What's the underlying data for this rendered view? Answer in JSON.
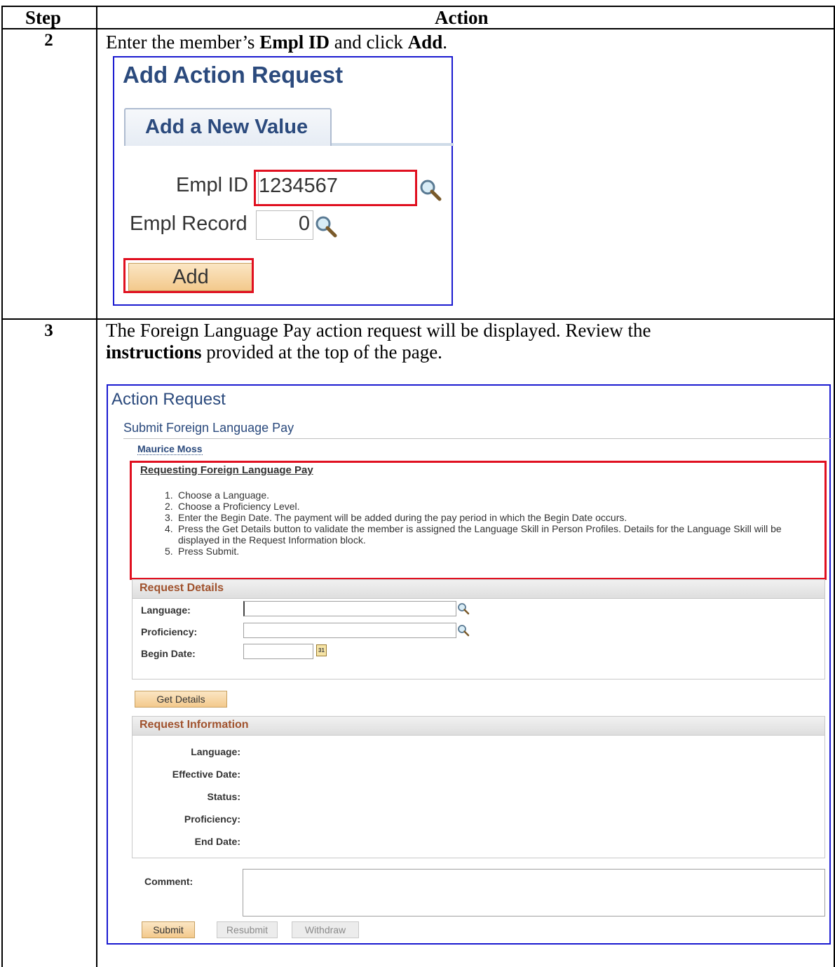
{
  "table": {
    "header": {
      "step": "Step",
      "action": "Action"
    }
  },
  "step2": {
    "number": "2",
    "instruction": {
      "text1": "Enter the member’s ",
      "bold1": "Empl ID",
      "text2": " and click ",
      "bold2": "Add",
      "text3": "."
    },
    "screen": {
      "title": "Add Action Request",
      "tab": "Add a New Value",
      "empl_id_label": "Empl ID",
      "empl_id_value": "1234567",
      "empl_record_label": "Empl Record",
      "empl_record_value": "0",
      "add_button": "Add"
    }
  },
  "step3": {
    "number": "3",
    "instruction": {
      "line1": "The Foreign Language Pay action request will be displayed.  Review the",
      "bold": "instructions",
      "line2": " provided at the top of the page."
    },
    "screen": {
      "title": "Action Request",
      "subtitle": "Submit Foreign Language Pay",
      "member_name": "Maurice Moss",
      "instructions_title": "Requesting Foreign Language Pay",
      "instructions": [
        {
          "n": "1.",
          "text": "Choose a Language."
        },
        {
          "n": "2.",
          "text": "Choose a Proficiency Level."
        },
        {
          "n": "3.",
          "text": "Enter the Begin Date. The payment will be added during the pay period in which the Begin Date occurs."
        },
        {
          "n": "4.",
          "text": "Press the Get Details button to validate the member is assigned the Language Skill in Person Profiles. Details for the Language Skill will be displayed in the Request Information block."
        },
        {
          "n": "5.",
          "text": "Press Submit."
        }
      ],
      "request_details": {
        "heading": "Request Details",
        "language_label": "Language:",
        "proficiency_label": "Proficiency:",
        "begin_date_label": "Begin Date:",
        "calendar_day": "31"
      },
      "get_details_button": "Get Details",
      "request_information": {
        "heading": "Request Information",
        "labels": [
          "Language:",
          "Effective Date:",
          "Status:",
          "Proficiency:",
          "End Date:"
        ]
      },
      "comment_label": "Comment:",
      "buttons": {
        "submit": "Submit",
        "resubmit": "Resubmit",
        "withdraw": "Withdraw"
      }
    }
  }
}
